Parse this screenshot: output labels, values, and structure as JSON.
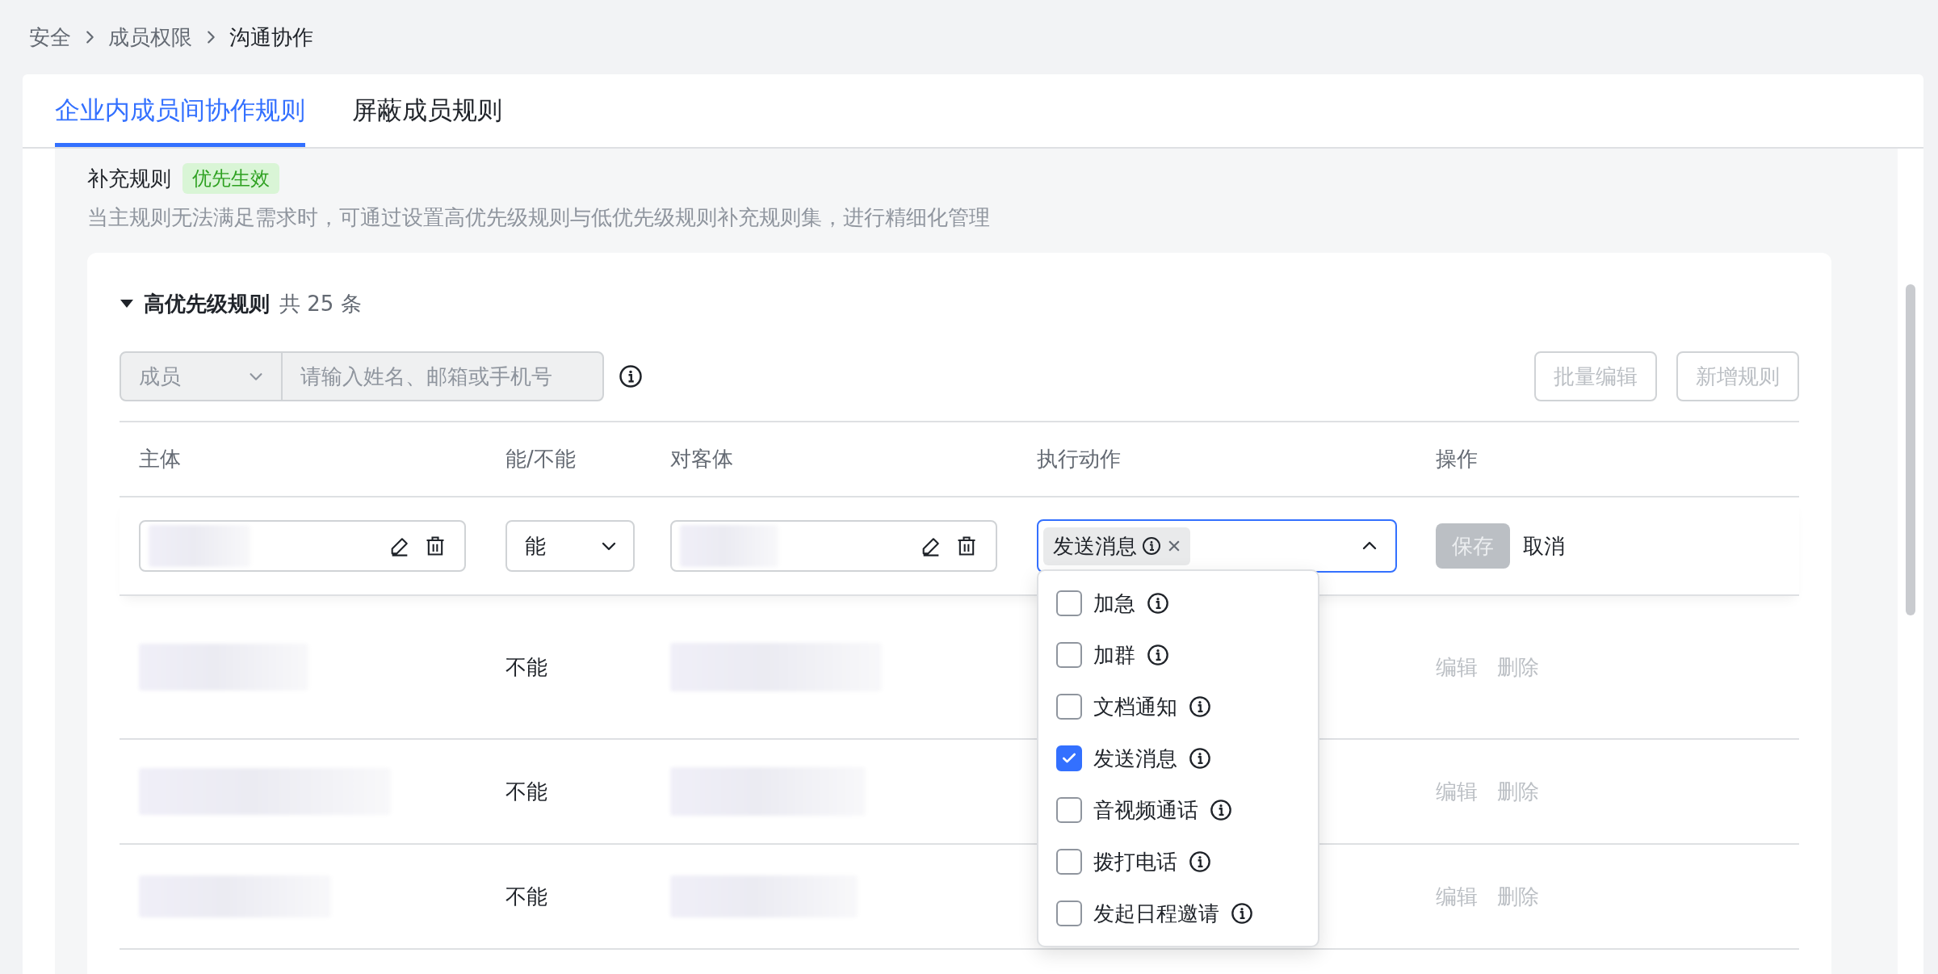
{
  "breadcrumb": [
    {
      "label": "安全"
    },
    {
      "label": "成员权限"
    },
    {
      "label": "沟通协作"
    }
  ],
  "tabs": [
    {
      "label": "企业内成员间协作规则",
      "selected": true
    },
    {
      "label": "屏蔽成员规则",
      "selected": false
    }
  ],
  "section": {
    "title": "补充规则",
    "tag": "优先生效",
    "description": "当主规则无法满足需求时，可通过设置高优先级规则与低优先级规则补充规则集，进行精细化管理"
  },
  "group": {
    "title": "高优先级规则",
    "expanded": true,
    "count": "共 25 条",
    "filter": {
      "type_select": "成员",
      "placeholder": "请输入姓名、邮箱或手机号"
    },
    "buttons": [
      {
        "label": "批量编辑",
        "disabled": true
      },
      {
        "label": "新增规则",
        "disabled": true
      }
    ],
    "table": {
      "columns": [
        "主体",
        "能/不能",
        "对客体",
        "执行动作",
        "操作"
      ],
      "edit_row": {
        "permission": "能",
        "tags": [
          "发送消息"
        ],
        "dropdown_open": true,
        "save": {
          "label": "保存",
          "disabled": true
        },
        "cancel": "取消",
        "options": [
          {
            "label": "加急",
            "checked": false
          },
          {
            "label": "加群",
            "checked": false
          },
          {
            "label": "文档通知",
            "checked": false
          },
          {
            "label": "发送消息",
            "checked": true
          },
          {
            "label": "音视频通话",
            "checked": false
          },
          {
            "label": "拨打电话",
            "checked": false
          },
          {
            "label": "发起日程邀请",
            "checked": false
          }
        ]
      },
      "rows": [
        {
          "permission": "不能",
          "actions": [
            {
              "label": "编辑",
              "disabled": true
            },
            {
              "label": "删除",
              "disabled": true
            }
          ]
        },
        {
          "permission": "不能",
          "actions": [
            {
              "label": "编辑",
              "disabled": true
            },
            {
              "label": "删除",
              "disabled": true
            }
          ]
        },
        {
          "permission": "不能",
          "actions": [
            {
              "label": "编辑",
              "disabled": true
            },
            {
              "label": "删除",
              "disabled": true
            }
          ]
        }
      ]
    }
  }
}
